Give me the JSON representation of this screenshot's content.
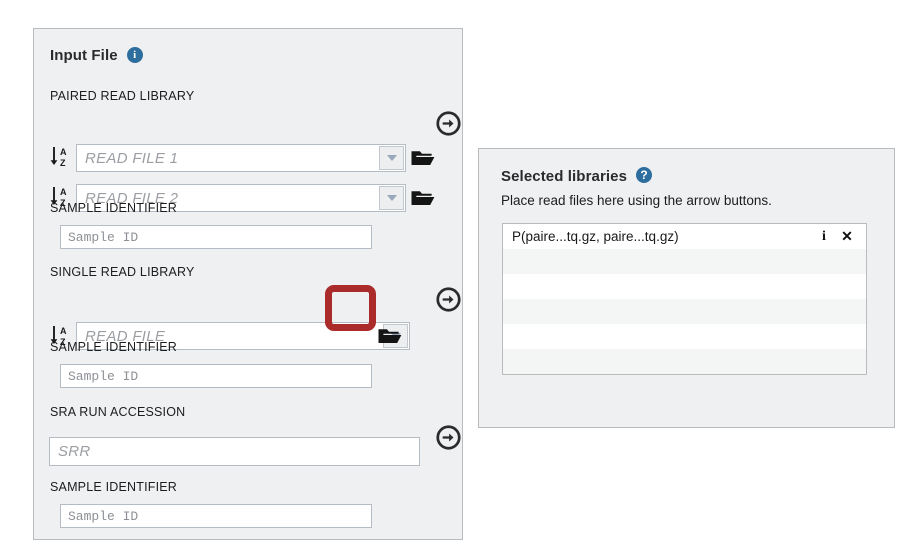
{
  "input_file_panel": {
    "title": "Input File",
    "info_icon": "info-icon",
    "paired_section": {
      "label": "PAIRED READ LIBRARY",
      "read_file_1": {
        "placeholder": "READ FILE 1",
        "value": "",
        "sort_icon": "sort-az-icon",
        "dropdown_icon": "chevron-down-icon",
        "browse_icon": "folder-open-icon"
      },
      "read_file_2": {
        "placeholder": "READ FILE 2",
        "value": "",
        "sort_icon": "sort-az-icon",
        "dropdown_icon": "chevron-down-icon",
        "browse_icon": "folder-open-icon"
      },
      "sample_identifier_label": "SAMPLE IDENTIFIER",
      "sample_identifier_placeholder": "Sample ID",
      "sample_identifier_value": "",
      "transfer_icon": "arrow-right-circle-icon"
    },
    "single_section": {
      "label": "SINGLE READ LIBRARY",
      "read_file": {
        "placeholder": "READ FILE",
        "value": "",
        "sort_icon": "sort-az-icon",
        "dropdown_icon": "chevron-down-icon",
        "browse_icon": "folder-open-icon"
      },
      "sample_identifier_label": "SAMPLE IDENTIFIER",
      "sample_identifier_placeholder": "Sample ID",
      "sample_identifier_value": "",
      "transfer_icon": "arrow-right-circle-icon"
    },
    "sra_section": {
      "label": "SRA RUN ACCESSION",
      "accession_placeholder": "SRR",
      "accession_value": "",
      "sample_identifier_label": "SAMPLE IDENTIFIER",
      "sample_identifier_placeholder": "Sample ID",
      "sample_identifier_value": "",
      "transfer_icon": "arrow-right-circle-icon"
    }
  },
  "selected_libraries_panel": {
    "title": "Selected libraries",
    "help_icon": "help-circle-icon",
    "hint": "Place read files here using the arrow buttons.",
    "items": [
      {
        "name": "P(paire...tq.gz, paire...tq.gz)",
        "info_label": "i",
        "remove_label": "✕"
      }
    ],
    "empty_row_count": 5
  },
  "annotation": {
    "highlight_target": "single-read-dropdown-button",
    "highlight_color": "#ab2b2b"
  },
  "colors": {
    "panel_background": "#eef0f1",
    "panel_border": "#b9bcbe",
    "accent_blue": "#2e6e9e",
    "input_border": "#b6bcc4",
    "highlight_red": "#ab2b2b"
  }
}
